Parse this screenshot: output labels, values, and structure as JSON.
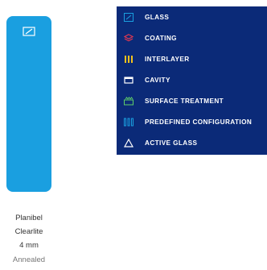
{
  "pane": {
    "color": "#1a9fe0",
    "icon": "glass-icon",
    "lines": [
      "Planibel",
      "Clearlite",
      "4 mm",
      "Annealed"
    ]
  },
  "menu": {
    "background": "#0b2a78",
    "items": [
      {
        "label": "GLASS",
        "icon": "glass-icon",
        "icon_color": "#1a9fe0"
      },
      {
        "label": "COATING",
        "icon": "coating-icon",
        "icon_color": "#e8384f"
      },
      {
        "label": "INTERLAYER",
        "icon": "interlayer-icon",
        "icon_color": "#f2c21b"
      },
      {
        "label": "CAVITY",
        "icon": "cavity-icon",
        "icon_color": "#ffffff"
      },
      {
        "label": "SURFACE TREATMENT",
        "icon": "surface-treatment-icon",
        "icon_color": "#5fd068"
      },
      {
        "label": "PREDEFINED CONFIGURATION",
        "icon": "predefined-configuration-icon",
        "icon_color": "#1a9fe0"
      },
      {
        "label": "ACTIVE GLASS",
        "icon": "active-glass-icon",
        "icon_color": "#ffffff"
      }
    ]
  }
}
